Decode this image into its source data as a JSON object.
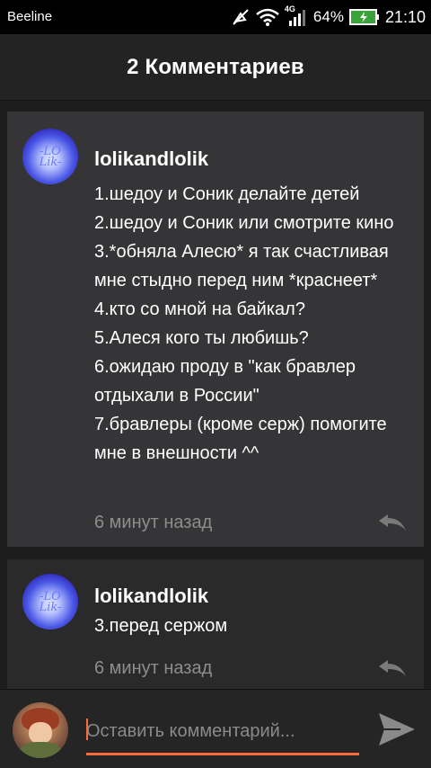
{
  "status_bar": {
    "carrier": "Beeline",
    "network": "4G",
    "battery": "64%",
    "time": "21:10",
    "icons": [
      "mute-icon",
      "wifi-icon",
      "signal-icon",
      "battery-charging-icon"
    ]
  },
  "header": {
    "title": "2 Комментариев"
  },
  "comments": [
    {
      "username": "lolikandlolik",
      "avatar_text": "-LO\nLik-",
      "text": "1.шедоу и Соник делайте детей\n2.шедоу и Соник или смотрите кино\n3.*обняла Алесю* я так счастливая мне стыдно перед ним *краснеет*\n4.кто со мной на байкал?\n5.Алеся кого ты любишь?\n6.ожидаю проду в \"как бравлер отдыхали в России\"\n7.бравлеры (кроме серж) помогите мне в внешности ^^",
      "time": "6 минут назад"
    },
    {
      "username": "lolikandlolik",
      "avatar_text": "-LO\nLik-",
      "text": "3.перед сержом",
      "time": "6 минут назад"
    }
  ],
  "input": {
    "placeholder": "Оставить комментарий..."
  },
  "colors": {
    "accent": "#ff6a3d",
    "background": "#1c1c1c"
  }
}
